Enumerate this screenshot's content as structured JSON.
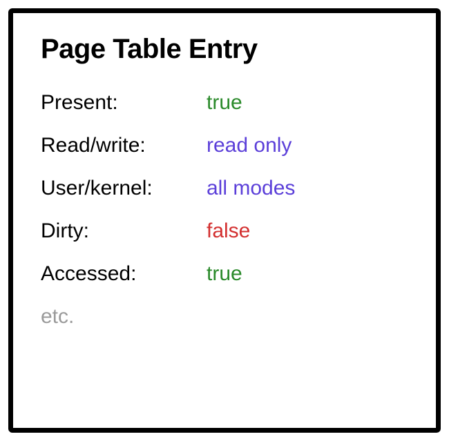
{
  "title": "Page Table Entry",
  "entries": [
    {
      "label": "Present:",
      "value": "true",
      "color": "green"
    },
    {
      "label": "Read/write:",
      "value": "read only",
      "color": "purple"
    },
    {
      "label": "User/kernel:",
      "value": "all modes",
      "color": "purple"
    },
    {
      "label": "Dirty:",
      "value": "false",
      "color": "red"
    },
    {
      "label": "Accessed:",
      "value": "true",
      "color": "green"
    }
  ],
  "footer": "etc."
}
